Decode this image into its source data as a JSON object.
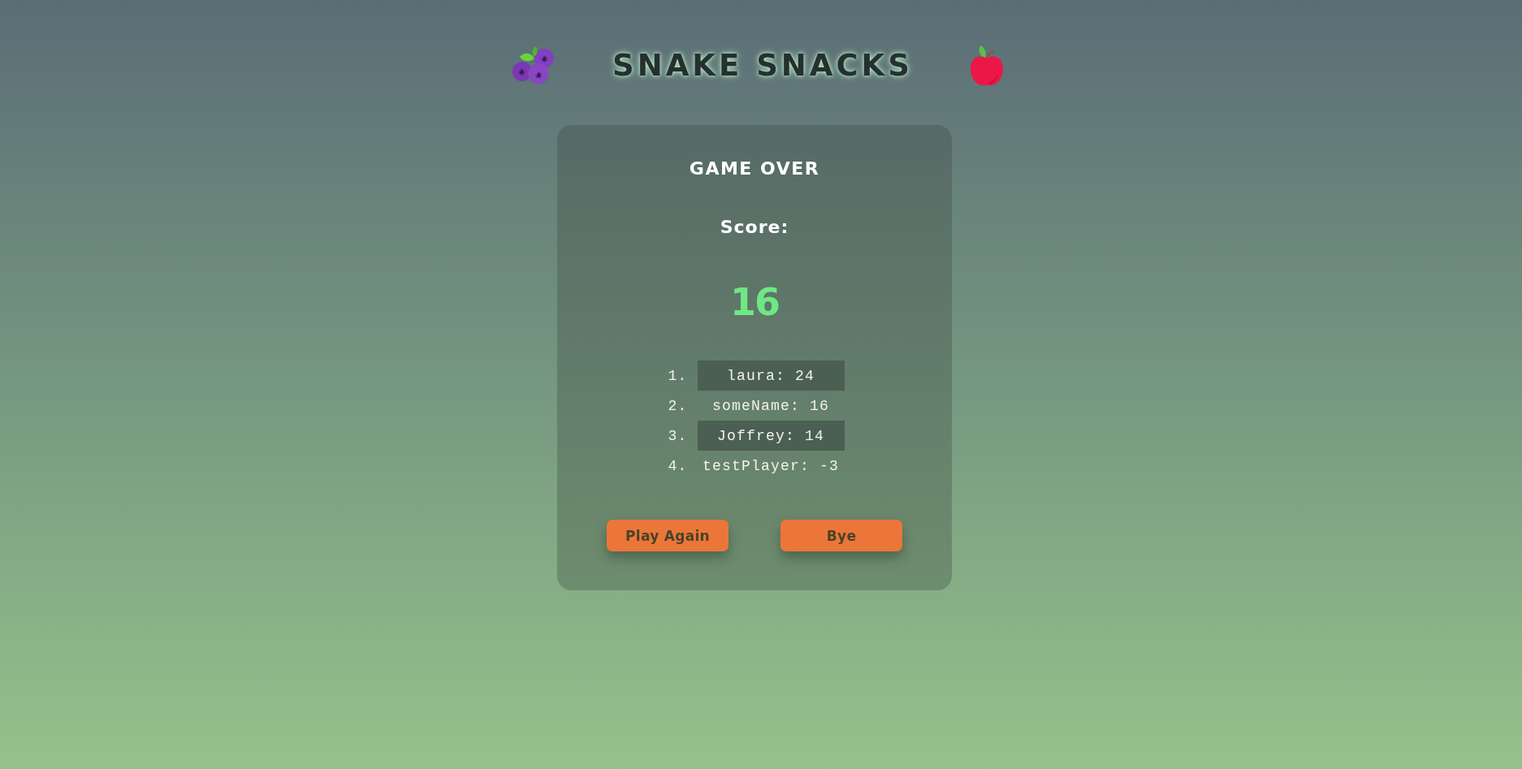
{
  "header": {
    "title": "SNAKE SNACKS"
  },
  "card": {
    "title": "GAME OVER",
    "score_label": "Score:",
    "score": "16",
    "leaderboard": [
      {
        "rank": "1.",
        "entry": "laura: 24"
      },
      {
        "rank": "2.",
        "entry": "someName: 16"
      },
      {
        "rank": "3.",
        "entry": "Joffrey: 14"
      },
      {
        "rank": "4.",
        "entry": "testPlayer: -3"
      }
    ],
    "buttons": [
      {
        "label": "Play Again"
      },
      {
        "label": "Bye"
      }
    ]
  }
}
